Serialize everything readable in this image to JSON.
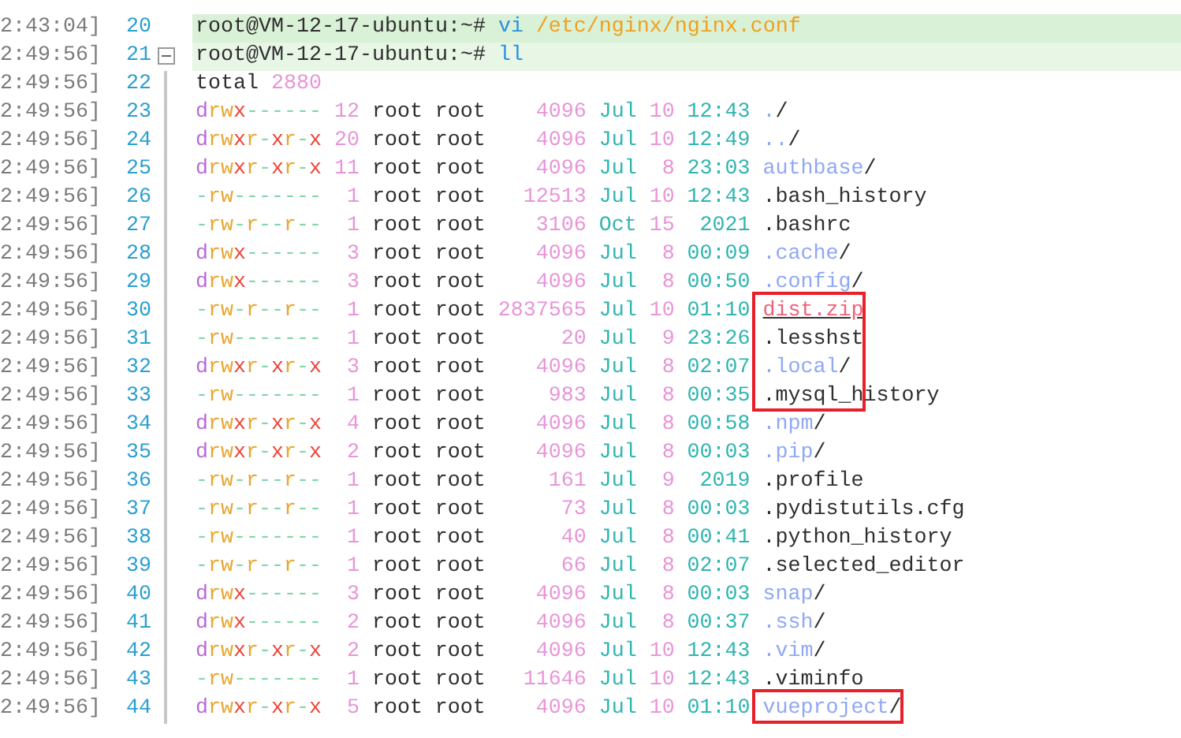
{
  "lines": [
    {
      "time": "2:43:04]",
      "number": "20",
      "kind": "command",
      "selected": true,
      "prompt": "root@VM-12-17-ubuntu:~#",
      "command": "vi",
      "args": "/etc/nginx/nginx.conf"
    },
    {
      "time": "2:49:56]",
      "number": "21",
      "kind": "command",
      "selected": false,
      "fold": {
        "expanded": true
      },
      "prompt": "root@VM-12-17-ubuntu:~#",
      "command": "ll"
    },
    {
      "time": "2:49:56]",
      "number": "22",
      "kind": "total",
      "selected": false,
      "label": "total",
      "value": "2880"
    },
    {
      "time": "2:49:56]",
      "number": "23",
      "kind": "entry",
      "selected": false,
      "boxed": false,
      "perms": "drwx------",
      "links": "12",
      "owner": "root",
      "group": "root",
      "size": "4096",
      "month": "Jul",
      "day": "10",
      "time_of_day": "12:43",
      "file": {
        "kind": "dir",
        "name": ".",
        "suffix": "/"
      }
    },
    {
      "time": "2:49:56]",
      "number": "24",
      "kind": "entry",
      "selected": false,
      "boxed": false,
      "perms": "drwxr-xr-x",
      "links": "20",
      "owner": "root",
      "group": "root",
      "size": "4096",
      "month": "Jul",
      "day": "10",
      "time_of_day": "12:49",
      "file": {
        "kind": "dir",
        "name": "..",
        "suffix": "/"
      }
    },
    {
      "time": "2:49:56]",
      "number": "25",
      "kind": "entry",
      "selected": false,
      "boxed": false,
      "perms": "drwxr-xr-x",
      "links": "11",
      "owner": "root",
      "group": "root",
      "size": "4096",
      "month": "Jul",
      "day": "8",
      "time_of_day": "23:03",
      "file": {
        "kind": "dir",
        "name": "authbase",
        "suffix": "/"
      }
    },
    {
      "time": "2:49:56]",
      "number": "26",
      "kind": "entry",
      "selected": false,
      "boxed": false,
      "perms": "-rw-------",
      "links": "1",
      "owner": "root",
      "group": "root",
      "size": "12513",
      "month": "Jul",
      "day": "10",
      "time_of_day": "12:43",
      "file": {
        "kind": "file",
        "name": ".bash_history"
      }
    },
    {
      "time": "2:49:56]",
      "number": "27",
      "kind": "entry",
      "selected": false,
      "boxed": false,
      "perms": "-rw-r--r--",
      "links": "1",
      "owner": "root",
      "group": "root",
      "size": "3106",
      "month": "Oct",
      "day": "15",
      "time_of_day": "2021",
      "file": {
        "kind": "file",
        "name": ".bashrc"
      }
    },
    {
      "time": "2:49:56]",
      "number": "28",
      "kind": "entry",
      "selected": false,
      "boxed": false,
      "perms": "drwx------",
      "links": "3",
      "owner": "root",
      "group": "root",
      "size": "4096",
      "month": "Jul",
      "day": "8",
      "time_of_day": "00:09",
      "file": {
        "kind": "dir",
        "name": ".cache",
        "suffix": "/"
      }
    },
    {
      "time": "2:49:56]",
      "number": "29",
      "kind": "entry",
      "selected": false,
      "boxed": false,
      "perms": "drwx------",
      "links": "3",
      "owner": "root",
      "group": "root",
      "size": "4096",
      "month": "Jul",
      "day": "8",
      "time_of_day": "00:50",
      "file": {
        "kind": "dir",
        "name": ".config",
        "suffix": "/"
      }
    },
    {
      "time": "2:49:56]",
      "number": "30",
      "kind": "entry",
      "selected": false,
      "boxed": true,
      "perms": "-rw-r--r--",
      "links": "1",
      "owner": "root",
      "group": "root",
      "size": "2837565",
      "month": "Jul",
      "day": "10",
      "time_of_day": "01:10",
      "file": {
        "kind": "archive",
        "name": "dist.zip"
      }
    },
    {
      "time": "2:49:56]",
      "number": "31",
      "kind": "entry",
      "selected": false,
      "boxed": true,
      "perms": "-rw-------",
      "links": "1",
      "owner": "root",
      "group": "root",
      "size": "20",
      "month": "Jul",
      "day": "9",
      "time_of_day": "23:26",
      "file": {
        "kind": "file",
        "name": ".lesshst"
      }
    },
    {
      "time": "2:49:56]",
      "number": "32",
      "kind": "entry",
      "selected": false,
      "boxed": true,
      "perms": "drwxr-xr-x",
      "links": "3",
      "owner": "root",
      "group": "root",
      "size": "4096",
      "month": "Jul",
      "day": "8",
      "time_of_day": "02:07",
      "file": {
        "kind": "dir",
        "name": ".local",
        "suffix": "/"
      }
    },
    {
      "time": "2:49:56]",
      "number": "33",
      "kind": "entry",
      "selected": false,
      "boxed": true,
      "perms": "-rw-------",
      "links": "1",
      "owner": "root",
      "group": "root",
      "size": "983",
      "month": "Jul",
      "day": "8",
      "time_of_day": "00:35",
      "file": {
        "kind": "file",
        "name": ".mysql_history"
      }
    },
    {
      "time": "2:49:56]",
      "number": "34",
      "kind": "entry",
      "selected": false,
      "boxed": false,
      "perms": "drwxr-xr-x",
      "links": "4",
      "owner": "root",
      "group": "root",
      "size": "4096",
      "month": "Jul",
      "day": "8",
      "time_of_day": "00:58",
      "file": {
        "kind": "dir",
        "name": ".npm",
        "suffix": "/"
      }
    },
    {
      "time": "2:49:56]",
      "number": "35",
      "kind": "entry",
      "selected": false,
      "boxed": false,
      "perms": "drwxr-xr-x",
      "links": "2",
      "owner": "root",
      "group": "root",
      "size": "4096",
      "month": "Jul",
      "day": "8",
      "time_of_day": "00:03",
      "file": {
        "kind": "dir",
        "name": ".pip",
        "suffix": "/"
      }
    },
    {
      "time": "2:49:56]",
      "number": "36",
      "kind": "entry",
      "selected": false,
      "boxed": false,
      "perms": "-rw-r--r--",
      "links": "1",
      "owner": "root",
      "group": "root",
      "size": "161",
      "month": "Jul",
      "day": "9",
      "time_of_day": "2019",
      "file": {
        "kind": "file",
        "name": ".profile"
      }
    },
    {
      "time": "2:49:56]",
      "number": "37",
      "kind": "entry",
      "selected": false,
      "boxed": false,
      "perms": "-rw-r--r--",
      "links": "1",
      "owner": "root",
      "group": "root",
      "size": "73",
      "month": "Jul",
      "day": "8",
      "time_of_day": "00:03",
      "file": {
        "kind": "file",
        "name": ".pydistutils.cfg"
      }
    },
    {
      "time": "2:49:56]",
      "number": "38",
      "kind": "entry",
      "selected": false,
      "boxed": false,
      "perms": "-rw-------",
      "links": "1",
      "owner": "root",
      "group": "root",
      "size": "40",
      "month": "Jul",
      "day": "8",
      "time_of_day": "00:41",
      "file": {
        "kind": "file",
        "name": ".python_history"
      }
    },
    {
      "time": "2:49:56]",
      "number": "39",
      "kind": "entry",
      "selected": false,
      "boxed": false,
      "perms": "-rw-r--r--",
      "links": "1",
      "owner": "root",
      "group": "root",
      "size": "66",
      "month": "Jul",
      "day": "8",
      "time_of_day": "02:07",
      "file": {
        "kind": "file",
        "name": ".selected_editor"
      }
    },
    {
      "time": "2:49:56]",
      "number": "40",
      "kind": "entry",
      "selected": false,
      "boxed": false,
      "perms": "drwx------",
      "links": "3",
      "owner": "root",
      "group": "root",
      "size": "4096",
      "month": "Jul",
      "day": "8",
      "time_of_day": "00:03",
      "file": {
        "kind": "dir",
        "name": "snap",
        "suffix": "/"
      }
    },
    {
      "time": "2:49:56]",
      "number": "41",
      "kind": "entry",
      "selected": false,
      "boxed": false,
      "perms": "drwx------",
      "links": "2",
      "owner": "root",
      "group": "root",
      "size": "4096",
      "month": "Jul",
      "day": "8",
      "time_of_day": "00:37",
      "file": {
        "kind": "dir",
        "name": ".ssh",
        "suffix": "/"
      }
    },
    {
      "time": "2:49:56]",
      "number": "42",
      "kind": "entry",
      "selected": false,
      "boxed": false,
      "perms": "drwxr-xr-x",
      "links": "2",
      "owner": "root",
      "group": "root",
      "size": "4096",
      "month": "Jul",
      "day": "10",
      "time_of_day": "12:43",
      "file": {
        "kind": "dir",
        "name": ".vim",
        "suffix": "/"
      }
    },
    {
      "time": "2:49:56]",
      "number": "43",
      "kind": "entry",
      "selected": false,
      "boxed": false,
      "perms": "-rw-------",
      "links": "1",
      "owner": "root",
      "group": "root",
      "size": "11646",
      "month": "Jul",
      "day": "10",
      "time_of_day": "12:43",
      "file": {
        "kind": "file",
        "name": ".viminfo"
      }
    },
    {
      "time": "2:49:56]",
      "number": "44",
      "kind": "entry",
      "selected": false,
      "boxed": true,
      "perms": "drwxr-xr-x",
      "links": "5",
      "owner": "root",
      "group": "root",
      "size": "4096",
      "month": "Jul",
      "day": "10",
      "time_of_day": "01:10",
      "file": {
        "kind": "dir",
        "name": "vueproject",
        "suffix": "/"
      }
    }
  ]
}
